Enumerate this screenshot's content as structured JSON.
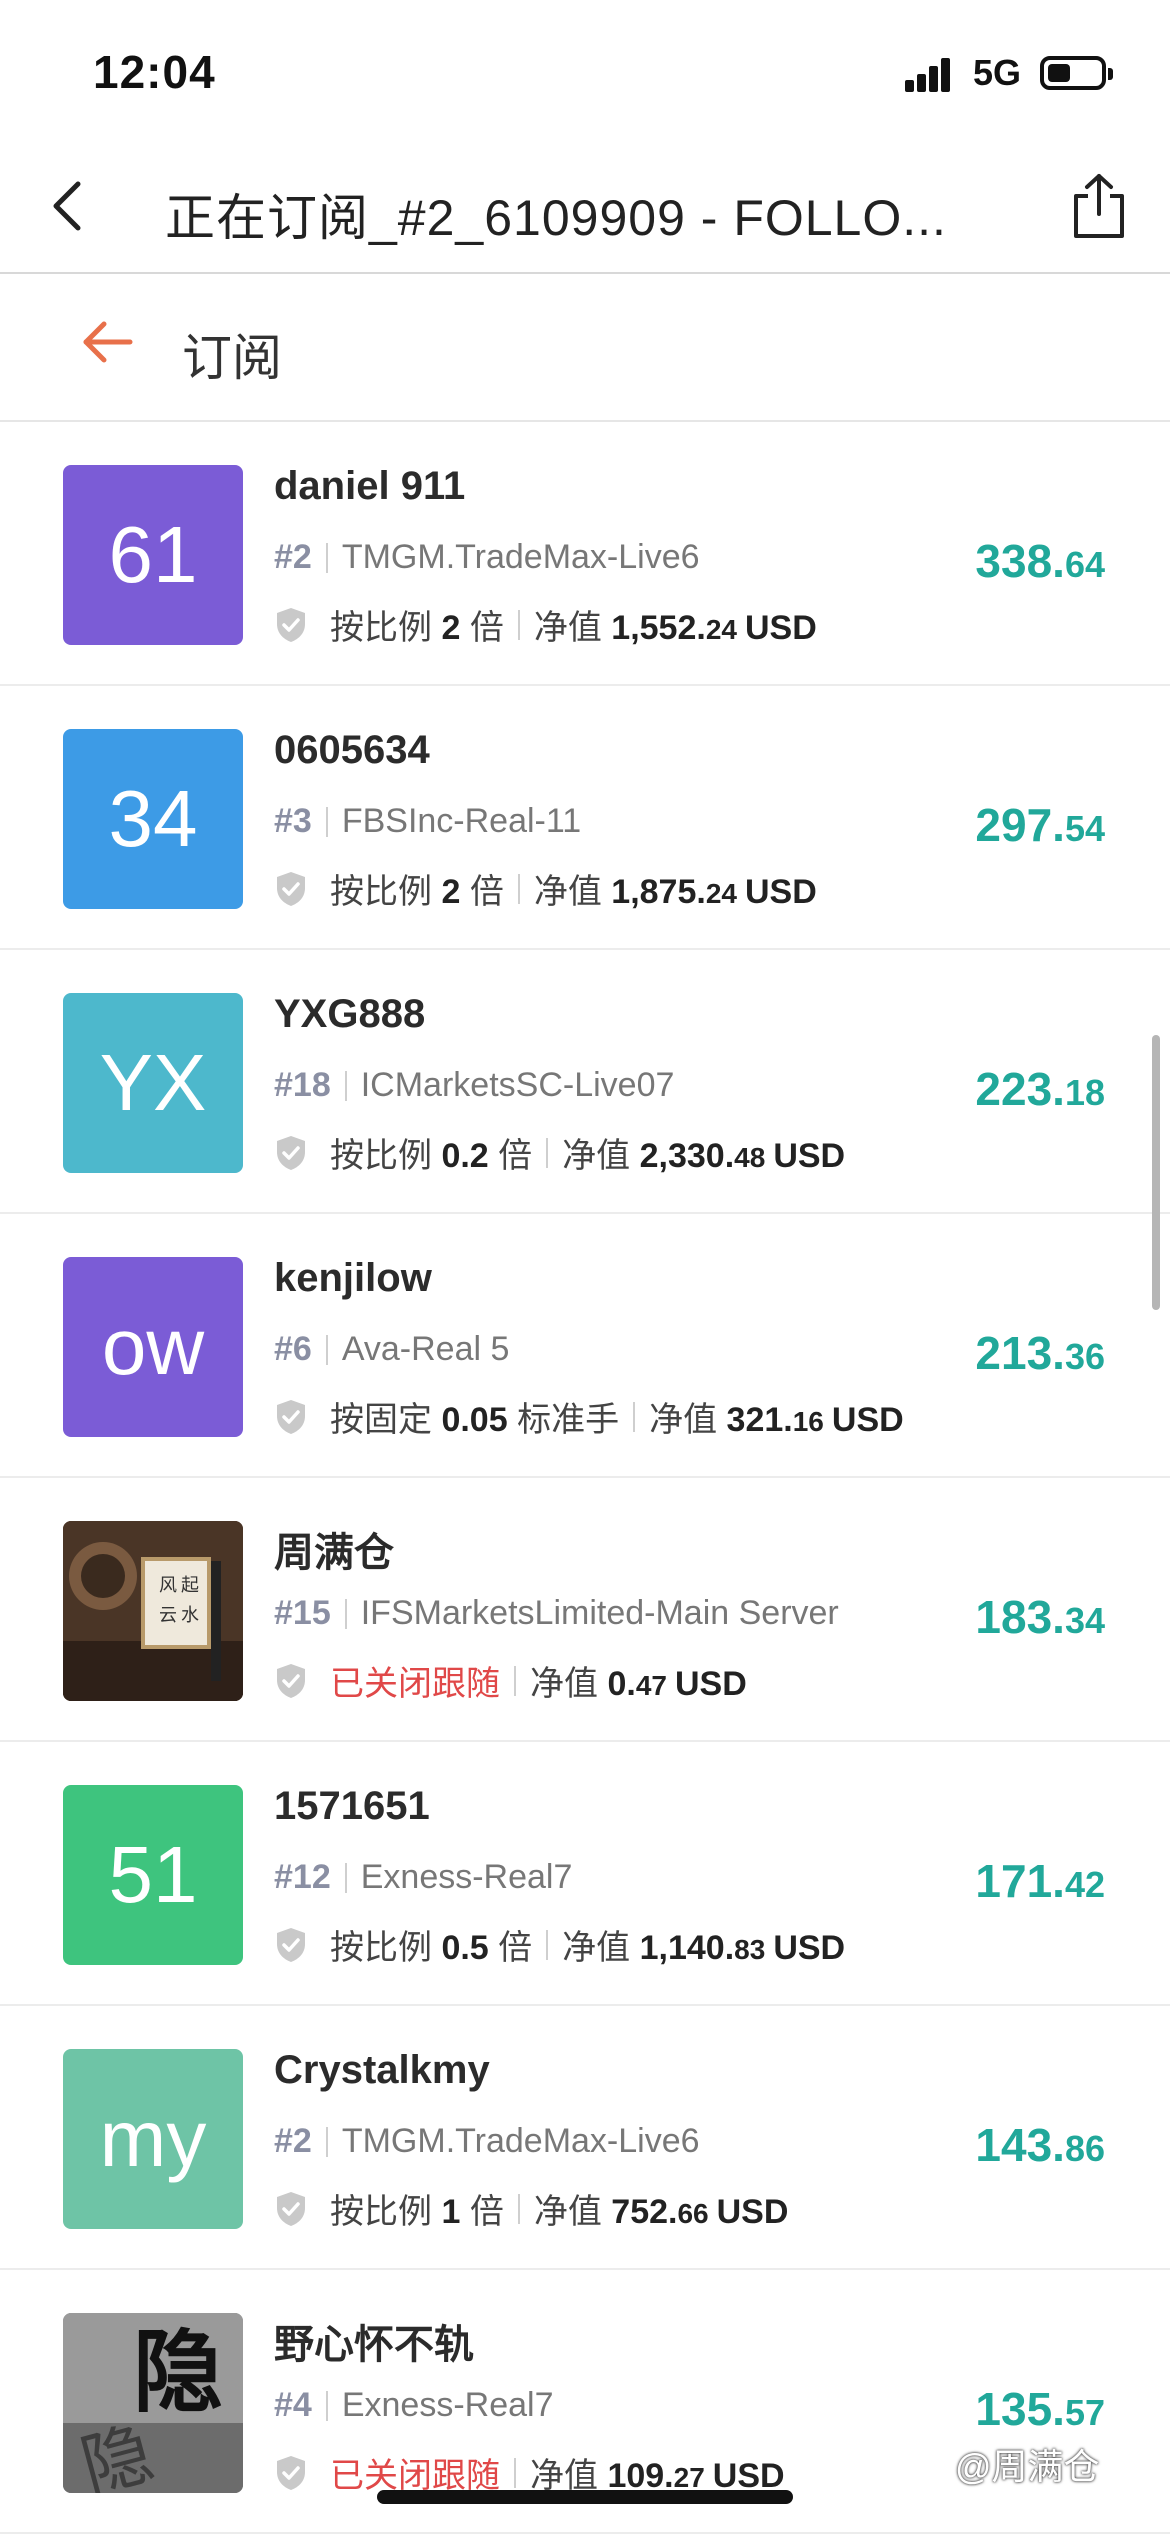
{
  "status_bar": {
    "time": "12:04",
    "network": "5G"
  },
  "nav": {
    "title": "正在订阅_#2_6109909 - FOLLO..."
  },
  "subheader": {
    "label": "订阅"
  },
  "colors": {
    "accent_green": "#21a89a",
    "closed_red": "#e04848",
    "back_arrow": "#e8704a"
  },
  "items": [
    {
      "avatar_text": "61",
      "avatar_color": "#7b5cd6",
      "name": "daniel 911",
      "rank": "#2",
      "server": "TMGM.TradeMax-Live6",
      "mode_prefix": "按比例",
      "mode_value": "2",
      "mode_suffix": "倍",
      "equity_label": "净值",
      "equity_int": "1,552.",
      "equity_dec": "24",
      "currency": "USD",
      "value_int": "338.",
      "value_dec": "64",
      "closed": false
    },
    {
      "avatar_text": "34",
      "avatar_color": "#3d9be6",
      "name": "0605634",
      "rank": "#3",
      "server": "FBSInc-Real-11",
      "mode_prefix": "按比例",
      "mode_value": "2",
      "mode_suffix": "倍",
      "equity_label": "净值",
      "equity_int": "1,875.",
      "equity_dec": "24",
      "currency": "USD",
      "value_int": "297.",
      "value_dec": "54",
      "closed": false
    },
    {
      "avatar_text": "YX",
      "avatar_color": "#4db8cc",
      "name": "YXG888",
      "rank": "#18",
      "server": "ICMarketsSC-Live07",
      "mode_prefix": "按比例",
      "mode_value": "0.2",
      "mode_suffix": "倍",
      "equity_label": "净值",
      "equity_int": "2,330.",
      "equity_dec": "48",
      "currency": "USD",
      "value_int": "223.",
      "value_dec": "18",
      "closed": false
    },
    {
      "avatar_text": "ow",
      "avatar_color": "#7b5cd6",
      "name": "kenjilow",
      "rank": "#6",
      "server": "Ava-Real 5",
      "mode_prefix": "按固定",
      "mode_value": "0.05",
      "mode_suffix": "标准手",
      "equity_label": "净值",
      "equity_int": "321.",
      "equity_dec": "16",
      "currency": "USD",
      "value_int": "213.",
      "value_dec": "36",
      "closed": false
    },
    {
      "avatar_text": "",
      "avatar_color": "#5a4030",
      "avatar_photo": "calligraphy-photo",
      "name": "周满仓",
      "rank": "#15",
      "server": "IFSMarketsLimited-Main Server",
      "closed_text": "已关闭跟随",
      "equity_label": "净值",
      "equity_int": "0.",
      "equity_dec": "47",
      "currency": "USD",
      "value_int": "183.",
      "value_dec": "34",
      "closed": true
    },
    {
      "avatar_text": "51",
      "avatar_color": "#3ec47e",
      "name": "1571651",
      "rank": "#12",
      "server": "Exness-Real7",
      "mode_prefix": "按比例",
      "mode_value": "0.5",
      "mode_suffix": "倍",
      "equity_label": "净值",
      "equity_int": "1,140.",
      "equity_dec": "83",
      "currency": "USD",
      "value_int": "171.",
      "value_dec": "42",
      "closed": false
    },
    {
      "avatar_text": "my",
      "avatar_color": "#6ec4a6",
      "name": "Crystalkmy",
      "rank": "#2",
      "server": "TMGM.TradeMax-Live6",
      "mode_prefix": "按比例",
      "mode_value": "1",
      "mode_suffix": "倍",
      "equity_label": "净值",
      "equity_int": "752.",
      "equity_dec": "66",
      "currency": "USD",
      "value_int": "143.",
      "value_dec": "86",
      "closed": false
    },
    {
      "avatar_text": "",
      "avatar_color": "#8a8a8a",
      "avatar_photo": "ink-character-photo",
      "name": "野心怀不轨",
      "rank": "#4",
      "server": "Exness-Real7",
      "closed_text": "已关闭跟随",
      "equity_label": "净值",
      "equity_int": "109.",
      "equity_dec": "27",
      "currency": "USD",
      "value_int": "135.",
      "value_dec": "57",
      "closed": true
    }
  ],
  "watermark": "@周满仓"
}
